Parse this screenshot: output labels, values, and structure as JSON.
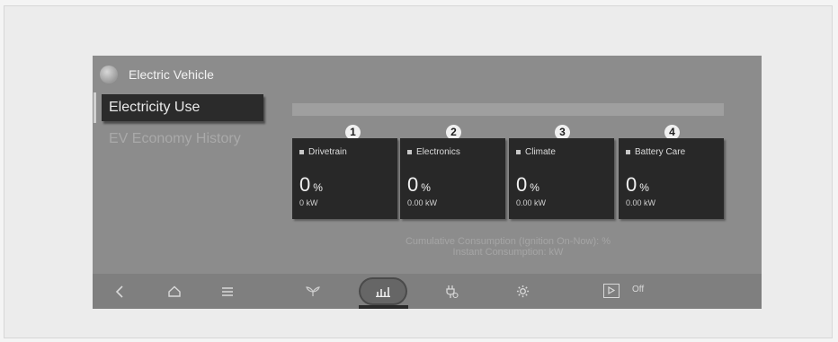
{
  "header": {
    "title": "Electric Vehicle",
    "icon": "globe-icon"
  },
  "menu": {
    "active": "Electricity Use",
    "inactive": "EV Economy History"
  },
  "badges": [
    "1",
    "2",
    "3",
    "4"
  ],
  "cards": [
    {
      "label": "Drivetrain",
      "value": "0",
      "unit": "%",
      "power": "0 kW"
    },
    {
      "label": "Electronics",
      "value": "0",
      "unit": "%",
      "power": "0.00 kW"
    },
    {
      "label": "Climate",
      "value": "0",
      "unit": "%",
      "power": "0.00 kW"
    },
    {
      "label": "Battery Care",
      "value": "0",
      "unit": "%",
      "power": "0.00 kW"
    }
  ],
  "consumption": {
    "cumulative": "Cumulative Consumption (Ignition On-Now): %",
    "instant": "Instant Consumption: kW"
  },
  "bottom_nav": {
    "icons": [
      "back-icon",
      "home-icon",
      "menu-icon",
      "eco-icon",
      "chart-icon",
      "charging-icon",
      "settings-icon",
      "play-icon"
    ],
    "play_state": "Off"
  },
  "colors": {
    "screen_bg": "#8c8c8c",
    "card_bg": "#282828",
    "active_bg": "#2b2b2b"
  }
}
